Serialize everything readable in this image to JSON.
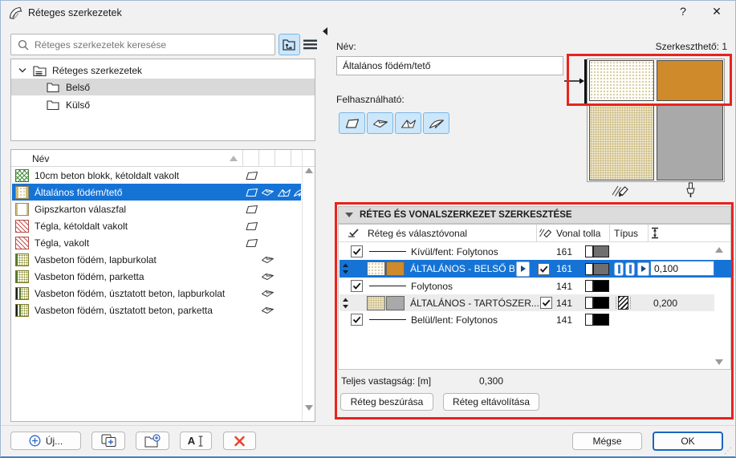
{
  "window": {
    "title": "Réteges szerkezetek",
    "help": "?",
    "close": "✕"
  },
  "search": {
    "placeholder": "Réteges szerkezetek keresése"
  },
  "tree": {
    "root": "Réteges szerkezetek",
    "items": [
      {
        "label": "Belső",
        "selected": true
      },
      {
        "label": "Külső",
        "selected": false
      }
    ]
  },
  "list": {
    "name_header": "Név",
    "items": [
      {
        "name": "10cm beton blokk, kétoldalt vakolt",
        "badges": [
          "wall"
        ]
      },
      {
        "name": "Általános födém/tető",
        "badges": [
          "wall",
          "slab",
          "roof",
          "shell"
        ],
        "selected": true
      },
      {
        "name": "Gipszkarton válaszfal",
        "badges": [
          "wall"
        ]
      },
      {
        "name": "Tégla, kétoldalt vakolt",
        "badges": [
          "wall"
        ]
      },
      {
        "name": "Tégla, vakolt",
        "badges": [
          "wall"
        ]
      },
      {
        "name": "Vasbeton födém, lapburkolat",
        "badges": [
          "slab"
        ]
      },
      {
        "name": "Vasbeton födém, parketta",
        "badges": [
          "slab"
        ]
      },
      {
        "name": "Vasbeton födém, úsztatott beton, lapburkolat",
        "badges": [
          "slab"
        ]
      },
      {
        "name": "Vasbeton födém, úsztatott beton, parketta",
        "badges": [
          "slab"
        ]
      }
    ]
  },
  "toolbar": {
    "new_label": "Új..."
  },
  "details": {
    "name_label": "Név:",
    "name_value": "Általános födém/tető",
    "editable_label": "Szerkeszthető: 1",
    "usable_label": "Felhasználható:"
  },
  "panel": {
    "title": "RÉTEG ÉS VONALSZERKEZET SZERKESZTÉSE",
    "columns": {
      "layer": "Réteg és választóvonal",
      "pen": "Vonal tolla",
      "type": "Típus"
    },
    "rows": [
      {
        "kind": "separator",
        "label": "Kívül/fent: Folytonos",
        "pen": "161"
      },
      {
        "kind": "layer",
        "label": "ÁLTALÁNOS - BELSŐ BURK...",
        "pen": "161",
        "thickness": "0,100",
        "selected": true
      },
      {
        "kind": "separator",
        "label": "Folytonos",
        "pen": "141"
      },
      {
        "kind": "layer",
        "label": "ÁLTALÁNOS - TARTÓSZER...",
        "pen": "141",
        "thickness": "0,200",
        "core": true
      },
      {
        "kind": "separator",
        "label": "Belül/lent: Folytonos",
        "pen": "141"
      }
    ],
    "total_label": "Teljes vastagság: [m]",
    "total_value": "0,300",
    "insert_button": "Réteg beszúrása",
    "remove_button": "Réteg eltávolítása"
  },
  "footer": {
    "cancel": "Mégse",
    "ok": "OK"
  },
  "colors": {
    "selection": "#1673d6",
    "annotation_red": "#e8231d",
    "surface_orange": "#cf8a2b",
    "surface_gray": "#a9a9a9",
    "pen_161": "#6f6f6f",
    "pen_141": "#000000"
  }
}
